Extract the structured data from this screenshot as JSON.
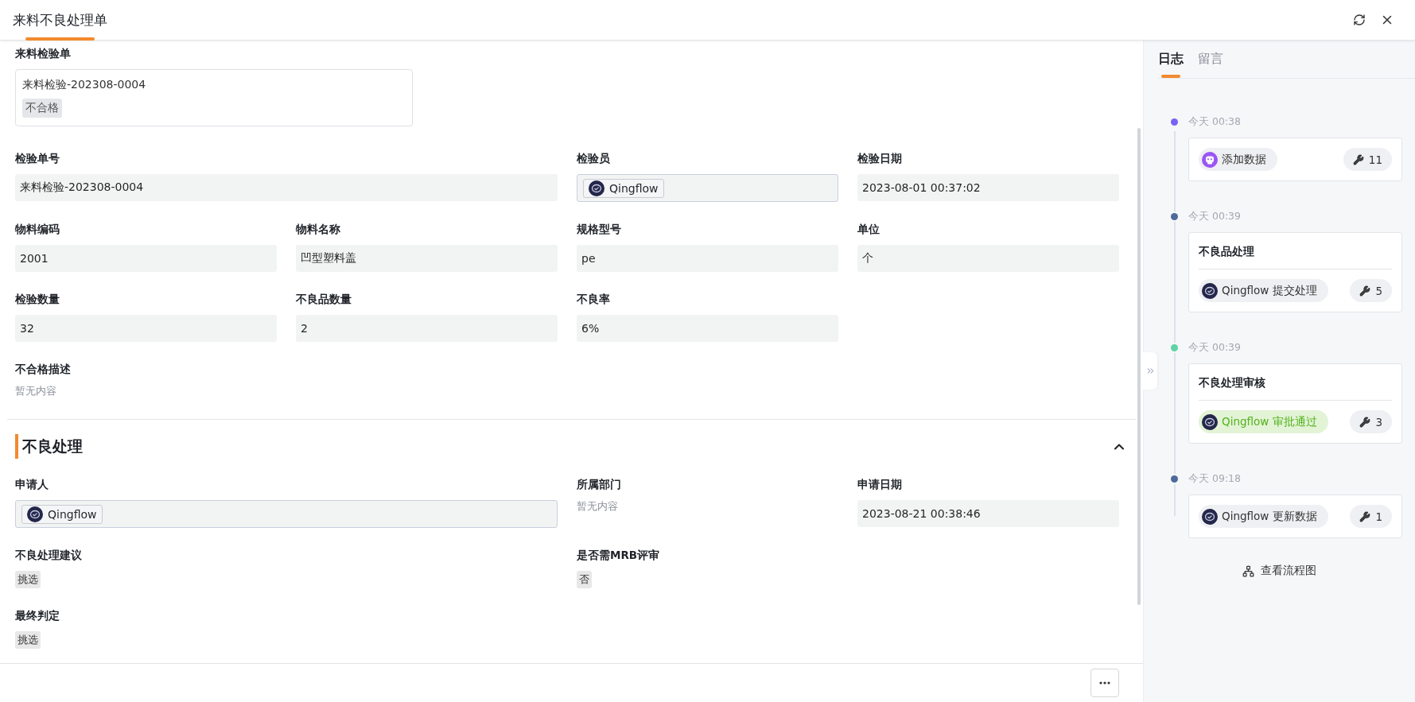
{
  "header": {
    "title": "来料不良处理单"
  },
  "reference": {
    "label": "来料检验单",
    "code": "来料检验-202308-0004",
    "tag": "不合格"
  },
  "sections": [
    {
      "rows": [
        [
          {
            "label": "检验单号",
            "kind": "text",
            "value": "来料检验-202308-0004"
          },
          "",
          {
            "label": "检验员",
            "kind": "user",
            "value": "Qingflow"
          },
          {
            "label": "检验日期",
            "kind": "text",
            "value": "2023-08-01 00:37:02"
          }
        ],
        [
          {
            "label": "物料编码",
            "kind": "text",
            "value": "2001"
          },
          {
            "label": "物料名称",
            "kind": "text",
            "value": "凹型塑料盖"
          },
          {
            "label": "规格型号",
            "kind": "text",
            "value": "pe"
          },
          {
            "label": "单位",
            "kind": "text",
            "value": "个"
          }
        ],
        [
          {
            "label": "检验数量",
            "kind": "text",
            "value": "32"
          },
          {
            "label": "不良品数量",
            "kind": "text",
            "value": "2"
          },
          {
            "label": "不良率",
            "kind": "text",
            "value": "6%"
          }
        ],
        [
          {
            "label": "不合格描述",
            "kind": "empty",
            "value": "暂无内容"
          }
        ]
      ]
    },
    {
      "title": "不良处理",
      "expanded": true,
      "rows": [
        [
          {
            "label": "申请人",
            "kind": "user",
            "value": "Qingflow"
          },
          "",
          {
            "label": "所属部门",
            "kind": "empty",
            "value": "暂无内容"
          },
          {
            "label": "申请日期",
            "kind": "text",
            "value": "2023-08-21 00:38:46"
          }
        ],
        [
          {
            "label": "不良处理建议",
            "kind": "tag",
            "value": "挑选"
          },
          "",
          {
            "label": "是否需MRB评审",
            "kind": "tag",
            "value": "否"
          }
        ],
        [
          {
            "label": "最终判定",
            "kind": "tag",
            "value": "挑选"
          }
        ]
      ]
    }
  ],
  "side_tabs": [
    {
      "label": "日志",
      "selected": true
    },
    {
      "label": "留言",
      "selected": false
    }
  ],
  "timeline": [
    {
      "time": "今天 00:38",
      "color": "#7b61f5",
      "actor": {
        "kind": "robot",
        "text": "添加数据"
      },
      "approved": false,
      "count": "11"
    },
    {
      "time": "今天 00:39",
      "color": "#4f6a99",
      "title": "不良品处理",
      "actor": {
        "kind": "user",
        "text": "Qingflow 提交处理"
      },
      "approved": false,
      "count": "5"
    },
    {
      "time": "今天 00:39",
      "color": "#5fd3a6",
      "title": "不良处理审核",
      "actor": {
        "kind": "user",
        "text": "Qingflow 审批通过"
      },
      "approved": true,
      "count": "3"
    },
    {
      "time": "今天 09:18",
      "color": "#4f6a99",
      "actor": {
        "kind": "user",
        "text": "Qingflow 更新数据"
      },
      "approved": false,
      "count": "1"
    }
  ],
  "flow_link": "查看流程图"
}
